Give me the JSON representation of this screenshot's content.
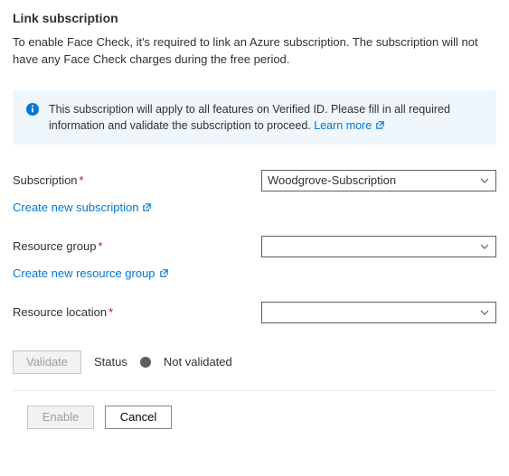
{
  "title": "Link subscription",
  "description": "To enable Face Check, it's required to link an Azure subscription. The subscription will not have any Face Check charges during the free period.",
  "infobox": {
    "text": "This subscription will apply to all features on Verified ID. Please fill in all required information and validate the subscription to proceed.",
    "learn_more": "Learn more"
  },
  "fields": {
    "subscription": {
      "label": "Subscription",
      "value": "Woodgrove-Subscription",
      "create_link": "Create new subscription"
    },
    "resource_group": {
      "label": "Resource group",
      "value": "",
      "create_link": "Create new resource group"
    },
    "resource_location": {
      "label": "Resource location",
      "value": ""
    }
  },
  "actions": {
    "validate": "Validate",
    "status_label": "Status",
    "status_text": "Not validated",
    "enable": "Enable",
    "cancel": "Cancel"
  }
}
